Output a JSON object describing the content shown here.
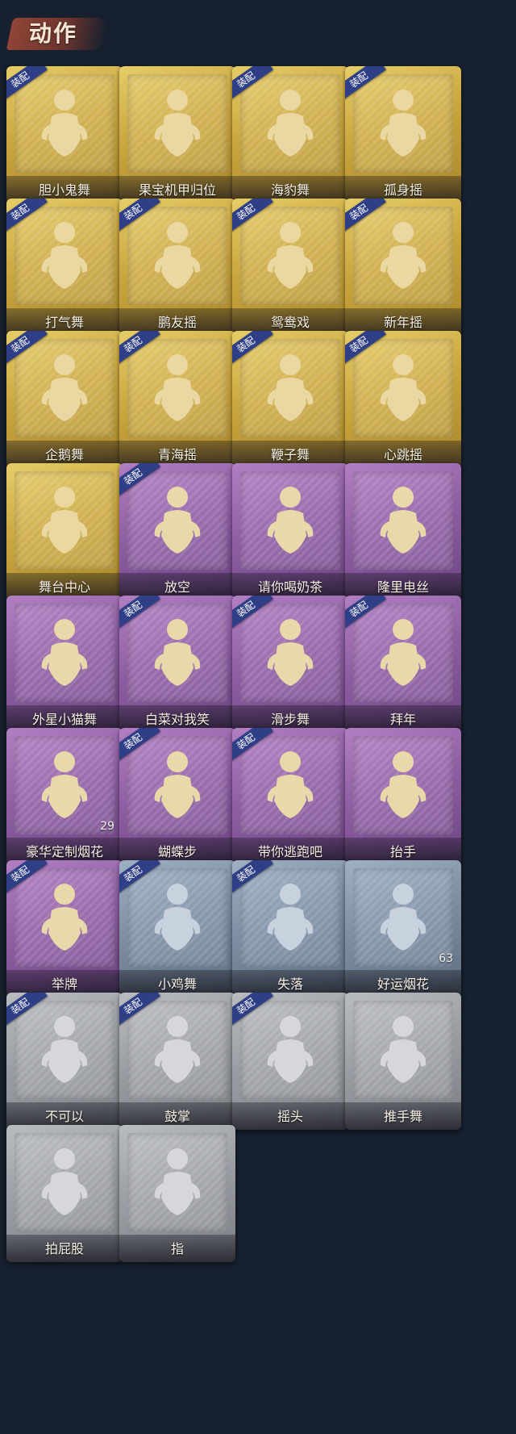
{
  "page": {
    "title": "动作"
  },
  "equip_badge_text": "装配",
  "colors": {
    "gold": "#c9a53e",
    "purple": "#8e5ea3",
    "blue": "#7d8ea3",
    "gray": "#9a9da3",
    "badge": "#2f3f87"
  },
  "actions": [
    {
      "name": "胆小鬼舞",
      "tier": "gold",
      "equipped": true,
      "count": ""
    },
    {
      "name": "果宝机甲归位",
      "tier": "gold",
      "equipped": false,
      "count": ""
    },
    {
      "name": "海豹舞",
      "tier": "gold",
      "equipped": true,
      "count": ""
    },
    {
      "name": "孤身摇",
      "tier": "gold",
      "equipped": true,
      "count": ""
    },
    {
      "name": "打气舞",
      "tier": "gold",
      "equipped": true,
      "count": ""
    },
    {
      "name": "鹏友摇",
      "tier": "gold",
      "equipped": true,
      "count": ""
    },
    {
      "name": "鸳鸯戏",
      "tier": "gold",
      "equipped": true,
      "count": ""
    },
    {
      "name": "新年摇",
      "tier": "gold",
      "equipped": true,
      "count": ""
    },
    {
      "name": "企鹅舞",
      "tier": "gold",
      "equipped": true,
      "count": ""
    },
    {
      "name": "青海摇",
      "tier": "gold",
      "equipped": true,
      "count": ""
    },
    {
      "name": "鞭子舞",
      "tier": "gold",
      "equipped": true,
      "count": ""
    },
    {
      "name": "心跳摇",
      "tier": "gold",
      "equipped": true,
      "count": ""
    },
    {
      "name": "舞台中心",
      "tier": "gold",
      "equipped": false,
      "count": ""
    },
    {
      "name": "放空",
      "tier": "purple",
      "equipped": true,
      "count": ""
    },
    {
      "name": "请你喝奶茶",
      "tier": "purple",
      "equipped": false,
      "count": ""
    },
    {
      "name": "隆里电丝",
      "tier": "purple",
      "equipped": false,
      "count": ""
    },
    {
      "name": "外星小猫舞",
      "tier": "purple",
      "equipped": false,
      "count": ""
    },
    {
      "name": "白菜对我笑",
      "tier": "purple",
      "equipped": true,
      "count": ""
    },
    {
      "name": "滑步舞",
      "tier": "purple",
      "equipped": true,
      "count": ""
    },
    {
      "name": "拜年",
      "tier": "purple",
      "equipped": true,
      "count": ""
    },
    {
      "name": "豪华定制烟花",
      "tier": "purple",
      "equipped": false,
      "count": "29"
    },
    {
      "name": "蝴蝶步",
      "tier": "purple",
      "equipped": true,
      "count": ""
    },
    {
      "name": "带你逃跑吧",
      "tier": "purple",
      "equipped": true,
      "count": ""
    },
    {
      "name": "抬手",
      "tier": "purple",
      "equipped": false,
      "count": ""
    },
    {
      "name": "举牌",
      "tier": "purple",
      "equipped": true,
      "count": ""
    },
    {
      "name": "小鸡舞",
      "tier": "blue",
      "equipped": true,
      "count": ""
    },
    {
      "name": "失落",
      "tier": "blue",
      "equipped": true,
      "count": ""
    },
    {
      "name": "好运烟花",
      "tier": "blue",
      "equipped": false,
      "count": "63"
    },
    {
      "name": "不可以",
      "tier": "gray",
      "equipped": true,
      "count": ""
    },
    {
      "name": "鼓掌",
      "tier": "gray",
      "equipped": true,
      "count": ""
    },
    {
      "name": "摇头",
      "tier": "gray",
      "equipped": true,
      "count": ""
    },
    {
      "name": "推手舞",
      "tier": "gray",
      "equipped": false,
      "count": ""
    },
    {
      "name": "拍屁股",
      "tier": "gray",
      "equipped": false,
      "count": ""
    },
    {
      "name": "指",
      "tier": "gray",
      "equipped": false,
      "count": ""
    }
  ]
}
